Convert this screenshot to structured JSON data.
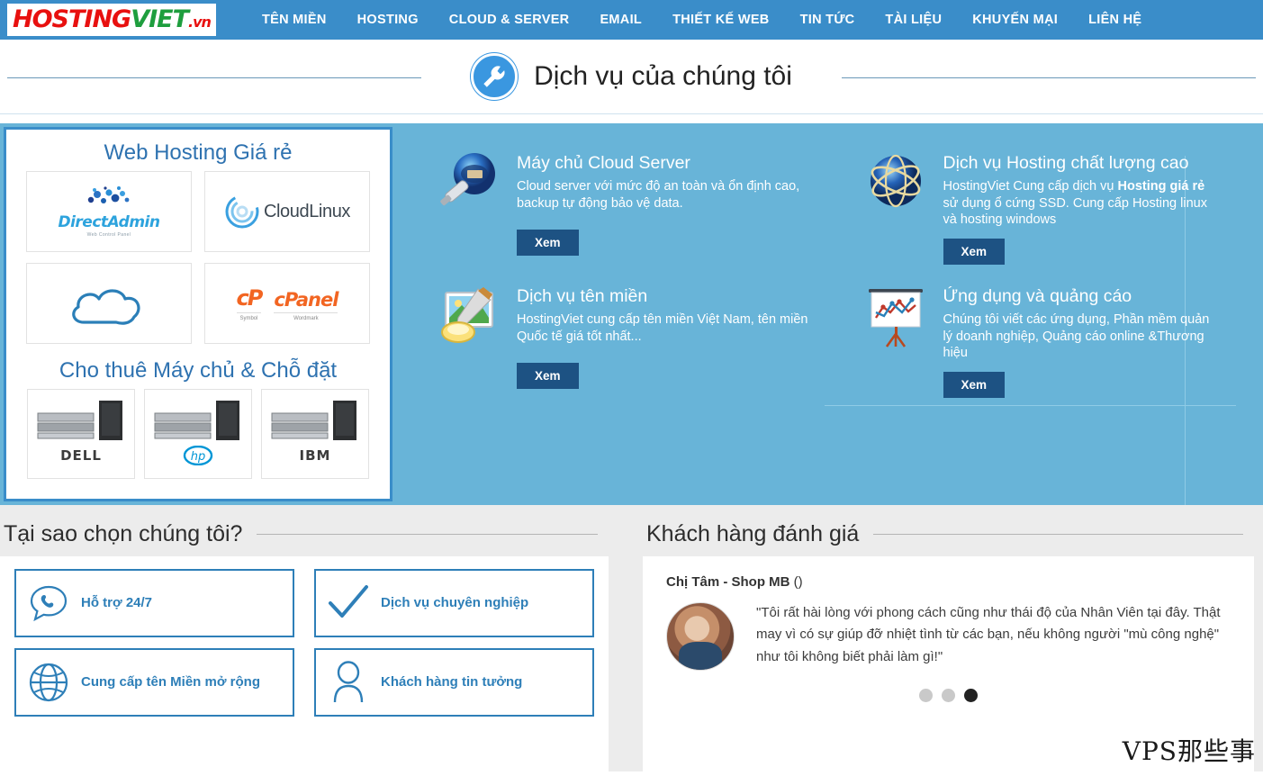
{
  "header": {
    "logo": {
      "part1": "HOSTING",
      "part2": "VIET",
      "part3": ".vn"
    },
    "nav": [
      {
        "label": "TÊN MIỀN"
      },
      {
        "label": "HOSTING"
      },
      {
        "label": "CLOUD & SERVER"
      },
      {
        "label": "EMAIL"
      },
      {
        "label": "THIẾT KẾ WEB"
      },
      {
        "label": "TIN TỨC"
      },
      {
        "label": "TÀI LIỆU"
      },
      {
        "label": "KHUYẾN MẠI"
      },
      {
        "label": "LIÊN HỆ"
      }
    ],
    "accent_color": "#3a8dc9"
  },
  "page_title": "Dịch vụ của chúng tôi",
  "left_panel": {
    "heading_hosting": "Web Hosting Giá rẻ",
    "heading_server": "Cho thuê Máy chủ & Chỗ đặt",
    "brands": [
      {
        "name": "DirectAdmin",
        "tagline": "Web Control Panel"
      },
      {
        "name": "CloudLinux"
      },
      {
        "name": "Cloud"
      },
      {
        "name": "cPanel",
        "symbol_caption": "Symbol",
        "wordmark_caption": "Wordmark",
        "symbol_text": "cP",
        "wordmark_text": "cPanel"
      }
    ],
    "servers": [
      {
        "label": "DELL"
      },
      {
        "label": "hp"
      },
      {
        "label": "IBM"
      }
    ]
  },
  "services": {
    "button_label": "Xem",
    "cards": [
      {
        "icon": "cloud-server-icon",
        "title": "Máy chủ Cloud Server",
        "desc": "Cloud server với mức độ an toàn và ổn định cao, backup tự động bảo vệ data.",
        "button": "Xem"
      },
      {
        "icon": "globe-network-icon",
        "title": "Dịch vụ Hosting chất lượng cao",
        "desc_1": "HostingViet Cung cấp dịch vụ ",
        "desc_bold": "Hosting giá rẻ",
        "desc_2": " sử dụng ổ cứng SSD. Cung cấp Hosting linux và hosting windows",
        "button": "Xem"
      },
      {
        "icon": "image-paint-icon",
        "title": "Dịch vụ tên miền",
        "desc": "HostingViet cung cấp tên miền Việt Nam, tên miền Quốc tế giá tốt nhất...",
        "button": "Xem"
      },
      {
        "icon": "presentation-chart-icon",
        "title": "Ứng dụng và quảng cáo",
        "desc": "Chúng tôi viết các ứng dụng, Phần mềm quản lý doanh nghiệp, Quảng cáo online &Thương hiệu",
        "button": "Xem"
      }
    ]
  },
  "why_us": {
    "title": "Tại sao chọn chúng tôi?",
    "features": [
      {
        "icon": "phone-bubble-icon",
        "label": "Hỗ trợ 24/7"
      },
      {
        "icon": "checkmark-icon",
        "label": "Dịch vụ chuyên nghiệp"
      },
      {
        "icon": "globe-icon",
        "label": "Cung cấp tên Miền mở rộng"
      },
      {
        "icon": "user-icon",
        "label": "Khách hàng tin tưởng"
      }
    ]
  },
  "testimonials": {
    "title": "Khách hàng đánh giá",
    "author": "Chị Tâm - Shop MB",
    "author_paren": " ()",
    "quote": "\"Tôi rất hài lòng với phong cách cũng như thái độ của Nhân Viên tại đây. Thật may vì có sự giúp đỡ nhiệt tình từ các bạn, nếu không người \"mù công nghệ\" như tôi không biết phải làm gì!\"",
    "dots_total": 3,
    "active_dot": 3
  },
  "watermark": "VPS那些事"
}
